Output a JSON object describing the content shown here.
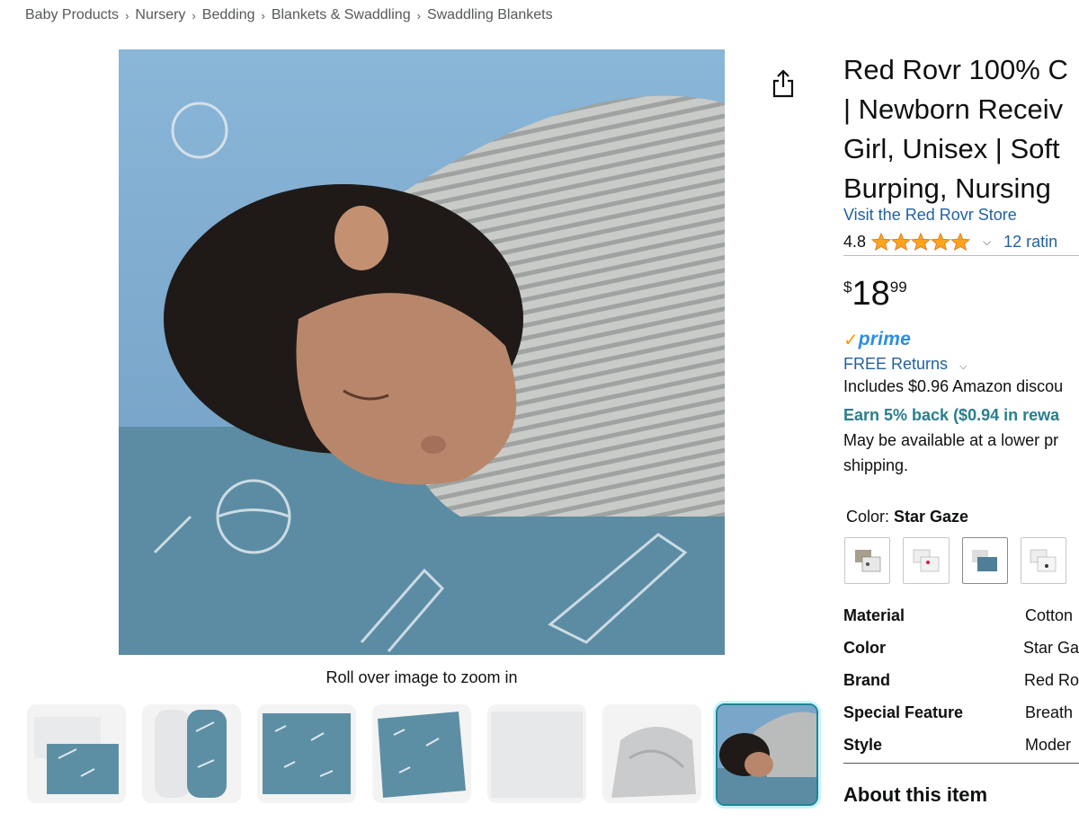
{
  "breadcrumb": [
    "Baby Products",
    "Nursery",
    "Bedding",
    "Blankets & Swaddling",
    "Swaddling Blankets"
  ],
  "image": {
    "zoom_hint": "Roll over image to zoom in",
    "thumbnail_count": 7,
    "selected_thumbnail": 7
  },
  "product": {
    "title_lines": [
      "Red Rovr 100% C",
      "| Newborn Receiv",
      "Girl, Unisex | Soft",
      "Burping, Nursing"
    ],
    "store_link": "Visit the Red Rovr Store",
    "rating": "4.8",
    "stars": 5,
    "ratings_count": "12 ratin"
  },
  "price": {
    "symbol": "$",
    "whole": "18",
    "fraction": "99"
  },
  "prime": {
    "check": "✓",
    "label": "prime"
  },
  "delivery": {
    "free_returns": "FREE Returns",
    "discount_line": "Includes $0.96 Amazon discou",
    "earn_line": "Earn 5% back ($0.94 in rewa",
    "lower_price_line1": "May be available at a lower pr",
    "lower_price_line2": "shipping."
  },
  "color": {
    "label": "Color:",
    "selected": "Star Gaze",
    "swatch_count": 4
  },
  "specs": [
    {
      "key": "Material",
      "value": "Cotton"
    },
    {
      "key": "Color",
      "value": "Star Ga"
    },
    {
      "key": "Brand",
      "value": "Red Ro"
    },
    {
      "key": "Special Feature",
      "value": "Breath"
    },
    {
      "key": "Style",
      "value": "Moder"
    }
  ],
  "about_heading": "About this item",
  "colors": {
    "link": "#2162a1",
    "teal": "#2a7d8f",
    "prime_blue": "#2a8ee1",
    "star": "#ffa41c",
    "blanket_blue": "#5b8ca3"
  }
}
